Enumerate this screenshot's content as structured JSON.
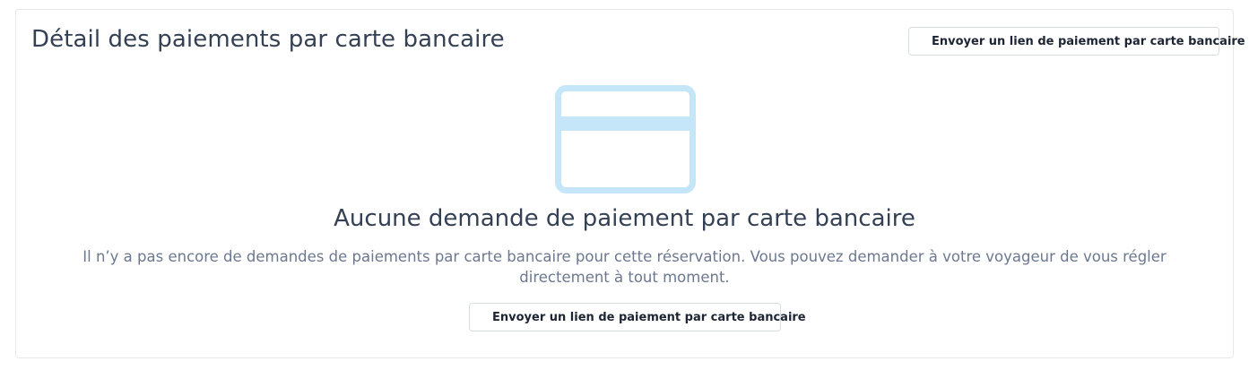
{
  "header": {
    "title": "Détail des paiements par carte bancaire",
    "send_link_button": "Envoyer un lien de paiement par carte bancaire"
  },
  "empty_state": {
    "icon": "credit-card-icon",
    "title": "Aucune demande de paiement par carte bancaire",
    "description": "Il n’y a pas encore de demandes de paiements par carte bancaire pour cette réservation. Vous pouvez demander à votre voyageur de vous régler directement à tout moment.",
    "send_link_button": "Envoyer un lien de paiement par carte bancaire"
  },
  "colors": {
    "illustration": "#c5e6f8",
    "text": "#344054",
    "muted_text": "#6c7890",
    "border": "#e6e8ec"
  }
}
